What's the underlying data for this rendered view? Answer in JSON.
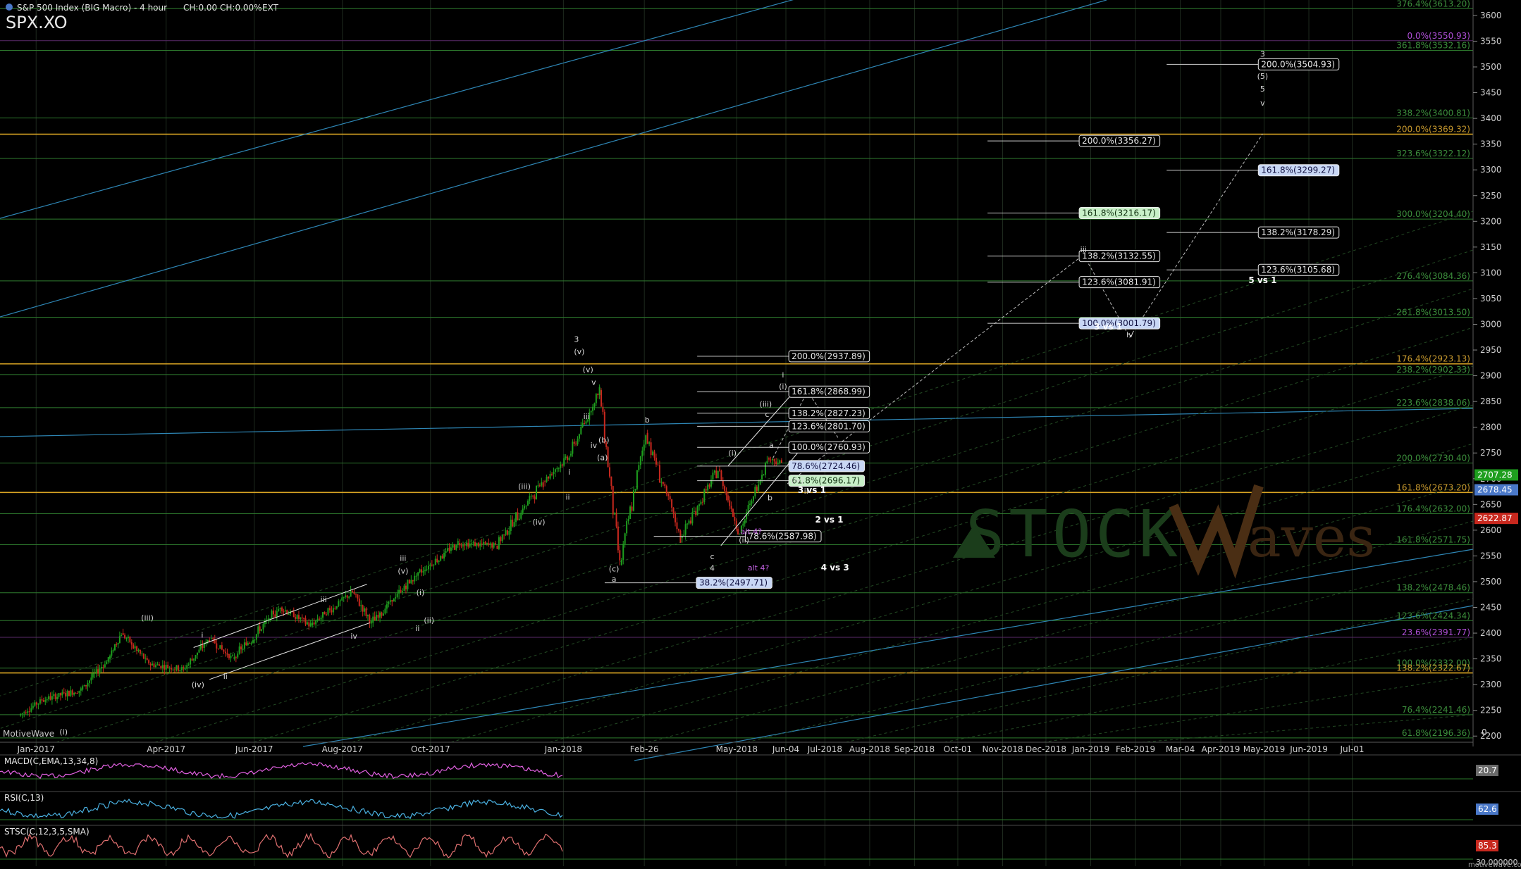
{
  "header": {
    "title": "S&P 500 Index (BIG Macro) - 4 hour",
    "ch": "CH:0.00",
    "chpct": "CH:0.00%",
    "ext": "EXT",
    "symbol": "SPX.XO",
    "brand": "MotiveWave",
    "watermark_a": "STOCK",
    "watermark_b": "aves",
    "site": "motivewave.com"
  },
  "colors": {
    "bg": "#000000",
    "grid": "#1f2a1f",
    "green_line": "#2f7d2f",
    "orange_line": "#d9a423",
    "cyan_line": "#2e86b5",
    "label_green": "#3c8f3c",
    "label_orange": "#c99a2e",
    "label_magenta": "#b04fd8",
    "text": "#e8e8e8",
    "box_blue": "#c8d7f5",
    "box_green": "#c8f0c8",
    "price_green": "#1e9e1e",
    "price_red": "#c8281e",
    "price_blue": "#4a78c8"
  },
  "chart_data": {
    "type": "candlestick",
    "title": "S&P 500 Index (BIG Macro) - 4 hour",
    "x_axis_labels": [
      "Jan-2017",
      "Apr-2017",
      "Jun-2017",
      "Aug-2017",
      "Oct-2017",
      "Jan-2018",
      "Feb-26",
      "May-2018",
      "Jun-04",
      "Jul-2018",
      "Aug-2018",
      "Sep-2018",
      "Oct-01",
      "Nov-2018",
      "Dec-2018",
      "Jan-2019",
      "Feb-2019",
      "Mar-04",
      "Apr-2019",
      "May-2019",
      "Jun-2019",
      "Jul-01"
    ],
    "y_axis_labels": [
      3600,
      3550,
      3500,
      3450,
      3400,
      3350,
      3300,
      3250,
      3200,
      3150,
      3100,
      3050,
      3000,
      2950,
      2900,
      2850,
      2800,
      2750,
      2700,
      2650,
      2600,
      2550,
      2500,
      2450,
      2400,
      2350,
      2300,
      2250,
      2200
    ],
    "ylim": [
      2188,
      3630
    ],
    "price_path": [
      [
        "2016-12-20",
        2240
      ],
      [
        "2017-01-05",
        2270
      ],
      [
        "2017-02-01",
        2290
      ],
      [
        "2017-02-20",
        2350
      ],
      [
        "2017-03-01",
        2400
      ],
      [
        "2017-03-20",
        2340
      ],
      [
        "2017-04-13",
        2330
      ],
      [
        "2017-05-01",
        2390
      ],
      [
        "2017-05-17",
        2350
      ],
      [
        "2017-06-19",
        2450
      ],
      [
        "2017-07-10",
        2415
      ],
      [
        "2017-08-08",
        2480
      ],
      [
        "2017-08-21",
        2420
      ],
      [
        "2017-09-20",
        2510
      ],
      [
        "2017-10-20",
        2575
      ],
      [
        "2017-11-15",
        2570
      ],
      [
        "2017-12-18",
        2695
      ],
      [
        "2018-01-05",
        2745
      ],
      [
        "2018-01-26",
        2872
      ],
      [
        "2018-02-09",
        2532
      ],
      [
        "2018-02-27",
        2789
      ],
      [
        "2018-03-23",
        2585
      ],
      [
        "2018-04-18",
        2718
      ],
      [
        "2018-05-03",
        2594
      ],
      [
        "2018-05-22",
        2740
      ],
      [
        "2018-06-01",
        2730
      ]
    ],
    "current_prices": {
      "price_a": "2707.28",
      "price_b": "2678.45",
      "price_c": "2622.87",
      "last_axis": "0"
    },
    "horizontal_levels_right": [
      {
        "label": "376.4%(3613.20)",
        "value": 3613.2,
        "color": "green"
      },
      {
        "label": "0.0%(3550.93)",
        "value": 3550.93,
        "color": "magenta"
      },
      {
        "label": "361.8%(3532.16)",
        "value": 3532.16,
        "color": "green"
      },
      {
        "label": "338.2%(3400.81)",
        "value": 3400.81,
        "color": "green"
      },
      {
        "label": "200.0%(3369.32)",
        "value": 3369.32,
        "color": "orange"
      },
      {
        "label": "323.6%(3322.12)",
        "value": 3322.12,
        "color": "green"
      },
      {
        "label": "300.0%(3204.40)",
        "value": 3204.4,
        "color": "green"
      },
      {
        "label": "276.4%(3084.36)",
        "value": 3084.36,
        "color": "green"
      },
      {
        "label": "261.8%(3013.50)",
        "value": 3013.5,
        "color": "green"
      },
      {
        "label": "176.4%(2923.13)",
        "value": 2923.13,
        "color": "orange"
      },
      {
        "label": "238.2%(2902.33)",
        "value": 2902.33,
        "color": "green"
      },
      {
        "label": "223.6%(2838.06)",
        "value": 2838.06,
        "color": "green"
      },
      {
        "label": "200.0%(2730.40)",
        "value": 2730.4,
        "color": "green"
      },
      {
        "label": "161.8%(2673.20)",
        "value": 2673.2,
        "color": "orange"
      },
      {
        "label": "176.4%(2632.00)",
        "value": 2632.0,
        "color": "green"
      },
      {
        "label": "161.8%(2571.75)",
        "value": 2571.75,
        "color": "green"
      },
      {
        "label": "138.2%(2478.46)",
        "value": 2478.46,
        "color": "green"
      },
      {
        "label": "123.6%(2424.34)",
        "value": 2424.34,
        "color": "green"
      },
      {
        "label": "23.6%(2391.77)",
        "value": 2391.77,
        "color": "magenta"
      },
      {
        "label": "100.0%(2332.00)",
        "value": 2332.0,
        "color": "green"
      },
      {
        "label": "138.2%(2322.67)",
        "value": 2322.67,
        "color": "orange"
      },
      {
        "label": "76.4%(2241.46)",
        "value": 2241.46,
        "color": "green"
      },
      {
        "label": "61.8%(2196.36)",
        "value": 2196.36,
        "color": "green"
      }
    ],
    "fib_boxes": [
      {
        "label": "200.0%(3504.93)",
        "value": 3504.93,
        "x": "2019-04-27",
        "style": "white"
      },
      {
        "label": "200.0%(3356.27)",
        "value": 3356.27,
        "x": "2018-12-24",
        "style": "white"
      },
      {
        "label": "161.8%(3299.27)",
        "value": 3299.27,
        "x": "2019-04-27",
        "style": "blue"
      },
      {
        "label": "161.8%(3216.17)",
        "value": 3216.17,
        "x": "2018-12-24",
        "style": "green"
      },
      {
        "label": "138.2%(3178.29)",
        "value": 3178.29,
        "x": "2019-04-27",
        "style": "white"
      },
      {
        "label": "138.2%(3132.55)",
        "value": 3132.55,
        "x": "2018-12-24",
        "style": "white"
      },
      {
        "label": "123.6%(3105.68)",
        "value": 3105.68,
        "x": "2019-04-27",
        "style": "white"
      },
      {
        "label": "123.6%(3081.91)",
        "value": 3081.91,
        "x": "2018-12-24",
        "style": "white"
      },
      {
        "label": "100.0%(3001.79)",
        "value": 3001.79,
        "x": "2018-12-24",
        "style": "blue"
      },
      {
        "label": "200.0%(2937.89)",
        "value": 2937.89,
        "x": "2018-06-06",
        "style": "white"
      },
      {
        "label": "161.8%(2868.99)",
        "value": 2868.99,
        "x": "2018-06-06",
        "style": "white"
      },
      {
        "label": "138.2%(2827.23)",
        "value": 2827.23,
        "x": "2018-06-06",
        "style": "white"
      },
      {
        "label": "123.6%(2801.70)",
        "value": 2801.7,
        "x": "2018-06-06",
        "style": "white"
      },
      {
        "label": "100.0%(2760.93)",
        "value": 2760.93,
        "x": "2018-06-06",
        "style": "white"
      },
      {
        "label": "78.6%(2724.46)",
        "value": 2724.46,
        "x": "2018-06-06",
        "style": "blue"
      },
      {
        "label": "61.8%(2696.17)",
        "value": 2696.17,
        "x": "2018-06-06",
        "style": "green"
      },
      {
        "label": "78.6%(2587.98)",
        "value": 2587.98,
        "x": "2018-05-07",
        "style": "white"
      },
      {
        "label": "38.2%(2497.71)",
        "value": 2497.71,
        "x": "2018-04-03",
        "style": "blue"
      }
    ],
    "annotations": [
      {
        "text": "5 vs 1",
        "x": "2019-04-30",
        "y": 3080
      },
      {
        "text": "3 vs 1",
        "x": "2019-01-13",
        "y": 2990
      },
      {
        "text": "3 vs 1",
        "x": "2018-06-22",
        "y": 2672
      },
      {
        "text": "2 vs 1",
        "x": "2018-07-04",
        "y": 2615
      },
      {
        "text": "4 vs 3",
        "x": "2018-07-08",
        "y": 2522
      },
      {
        "text": "3",
        "x": "2019-04-30",
        "y": 3520
      },
      {
        "text": "(5)",
        "x": "2019-04-30",
        "y": 3477
      },
      {
        "text": "5",
        "x": "2019-04-30",
        "y": 3452
      },
      {
        "text": "v",
        "x": "2019-04-30",
        "y": 3425
      },
      {
        "text": "iii",
        "x": "2018-12-27",
        "y": 3140
      },
      {
        "text": "iv",
        "x": "2019-01-28",
        "y": 2975
      },
      {
        "text": "3",
        "x": "2018-01-10",
        "y": 2966
      },
      {
        "text": "(v)",
        "x": "2018-01-12",
        "y": 2942
      },
      {
        "text": "(v)",
        "x": "2018-01-18",
        "y": 2907
      },
      {
        "text": "v",
        "x": "2018-01-22",
        "y": 2882
      },
      {
        "text": "i",
        "x": "2018-06-02",
        "y": 2897
      },
      {
        "text": "(i)",
        "x": "2018-06-02",
        "y": 2874
      },
      {
        "text": "(iii)",
        "x": "2018-05-21",
        "y": 2840
      },
      {
        "text": "c",
        "x": "2018-05-22",
        "y": 2820
      },
      {
        "text": "b",
        "x": "2018-02-28",
        "y": 2809
      },
      {
        "text": "(b)",
        "x": "2018-01-29",
        "y": 2770
      },
      {
        "text": "(i)",
        "x": "2018-04-28",
        "y": 2745
      },
      {
        "text": "a",
        "x": "2018-05-25",
        "y": 2760
      },
      {
        "text": "(a)",
        "x": "2018-01-28",
        "y": 2736
      },
      {
        "text": "(iv)",
        "x": "2018-06-12",
        "y": 2692
      },
      {
        "text": "b",
        "x": "2018-05-24",
        "y": 2658
      },
      {
        "text": "ii",
        "x": "2018-06-18",
        "y": 2671
      },
      {
        "text": "(ii)",
        "x": "2018-05-06",
        "y": 2576
      },
      {
        "text": "alt 4?",
        "x": "2018-05-11",
        "y": 2592
      },
      {
        "text": "alt 4?",
        "x": "2018-05-16",
        "y": 2522
      },
      {
        "text": "c",
        "x": "2018-04-14",
        "y": 2544
      },
      {
        "text": "4",
        "x": "2018-04-14",
        "y": 2521
      },
      {
        "text": "(c)",
        "x": "2018-02-05",
        "y": 2520
      },
      {
        "text": "a",
        "x": "2018-02-05",
        "y": 2500
      },
      {
        "text": "iii",
        "x": "2017-09-12",
        "y": 2540
      },
      {
        "text": "(v)",
        "x": "2017-09-12",
        "y": 2516
      },
      {
        "text": "(i)",
        "x": "2017-09-24",
        "y": 2474
      },
      {
        "text": "(ii)",
        "x": "2017-09-30",
        "y": 2420
      },
      {
        "text": "ii",
        "x": "2017-09-22",
        "y": 2404
      },
      {
        "text": "iv",
        "x": "2017-08-09",
        "y": 2389
      },
      {
        "text": "(iii)",
        "x": "2017-03-19",
        "y": 2425
      },
      {
        "text": "(iv)",
        "x": "2017-04-23",
        "y": 2295
      },
      {
        "text": "ii",
        "x": "2017-05-12",
        "y": 2311
      },
      {
        "text": "i",
        "x": "2017-04-26",
        "y": 2391
      },
      {
        "text": "iii",
        "x": "2017-07-19",
        "y": 2460
      },
      {
        "text": "(iii)",
        "x": "2017-12-05",
        "y": 2680
      },
      {
        "text": "(iv)",
        "x": "2017-12-15",
        "y": 2611
      },
      {
        "text": "i",
        "x": "2018-01-05",
        "y": 2708
      },
      {
        "text": "iii",
        "x": "2018-01-17",
        "y": 2816
      },
      {
        "text": "iv",
        "x": "2018-01-22",
        "y": 2760
      },
      {
        "text": "ii",
        "x": "2018-01-04",
        "y": 2659
      },
      {
        "text": "(i)",
        "x": "2017-01-20",
        "y": 2203
      }
    ],
    "indicators": [
      {
        "name": "MACD(C,EMA,13,34,8)",
        "value": "20.7"
      },
      {
        "name": "RSI(C,13)",
        "value": "62.6"
      },
      {
        "name": "STSC(C,12,3,5,SMA)",
        "value": "85.3",
        "extra": "30.000000"
      }
    ]
  }
}
